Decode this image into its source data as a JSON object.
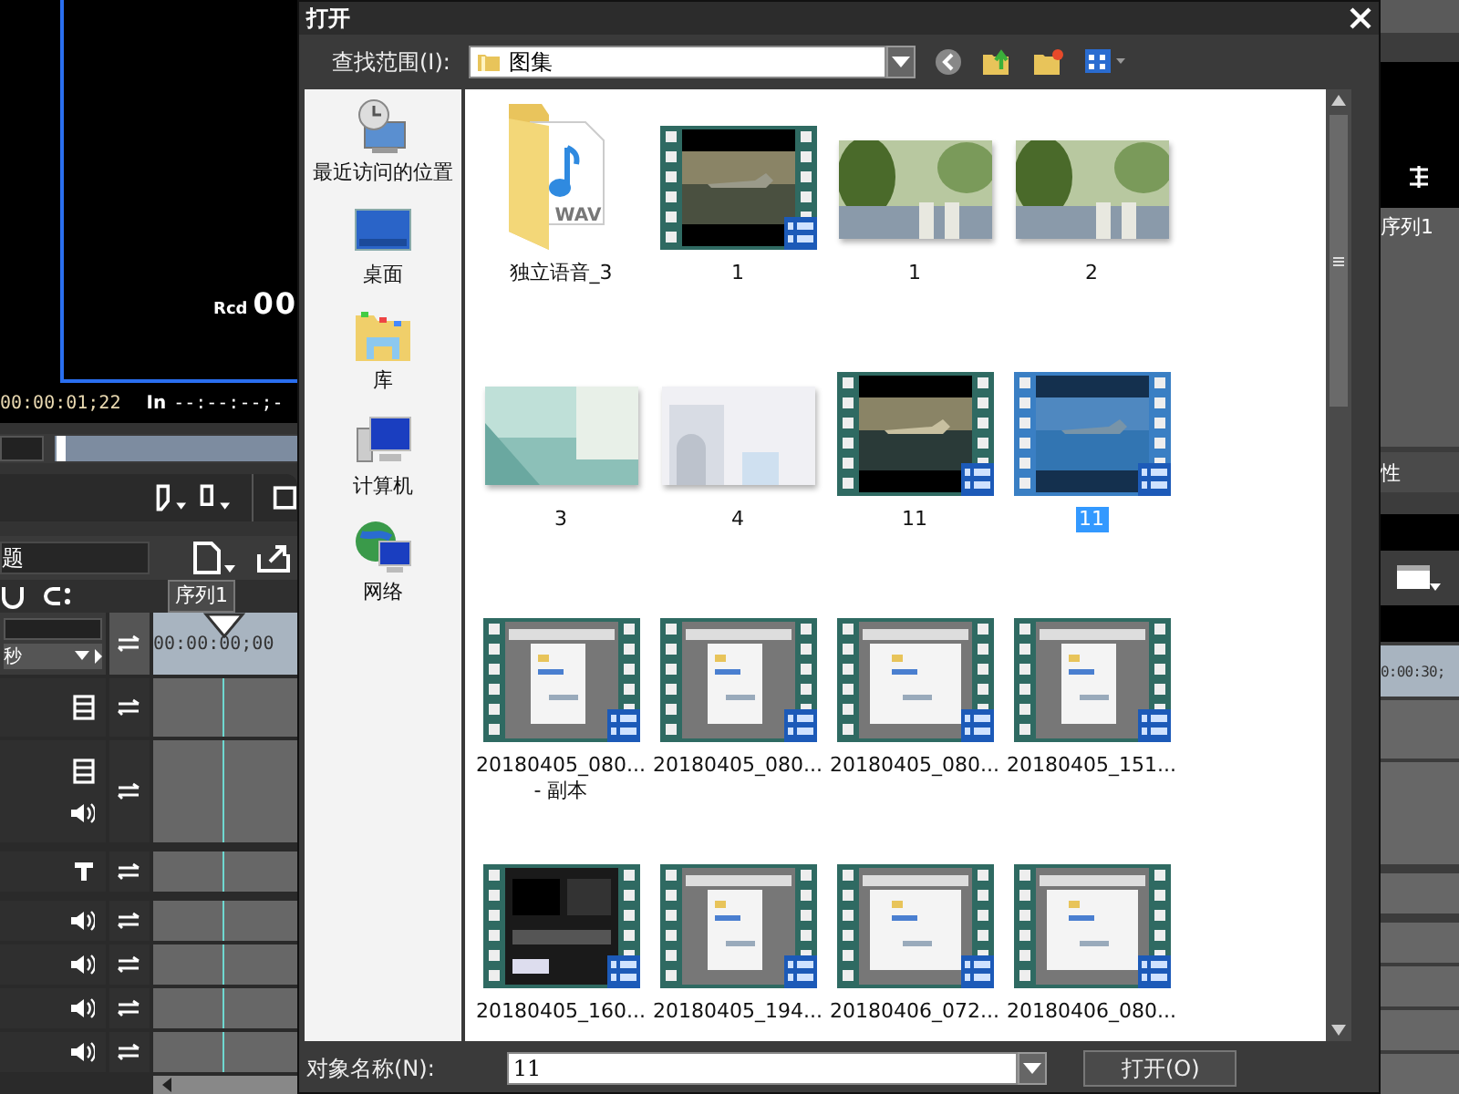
{
  "background_app": {
    "monitor": {
      "rcd_label": "Rcd",
      "rcd_value": "00"
    },
    "timecode": "00:00:01;22",
    "position": {
      "level": 0.01
    },
    "in_label": "In",
    "in_value": "--:--:--;-",
    "bin_title": "题",
    "unit": "秒",
    "sequence_tab": "序列1",
    "ruler_time": "00:00:00;00",
    "right_panel": {
      "sequence": "序列1",
      "property": "性",
      "ruler_time": "0:00:30;"
    }
  },
  "dialog": {
    "title": "打开",
    "look_in_label": "查找范围(I):",
    "look_in_value": "图集",
    "places": [
      {
        "kind": "recent",
        "label": "最近访问的位置"
      },
      {
        "kind": "desktop",
        "label": "桌面"
      },
      {
        "kind": "library",
        "label": "库"
      },
      {
        "kind": "computer",
        "label": "计算机"
      },
      {
        "kind": "network",
        "label": "网络"
      }
    ],
    "files": [
      {
        "kind": "folder",
        "name": "独立语音_3",
        "badge": "WAV",
        "selected": false
      },
      {
        "kind": "video",
        "name": "1",
        "selected": false
      },
      {
        "name": "1",
        "selected": false
      },
      {
        "name": "2",
        "selected": false
      },
      {
        "name": "3",
        "selected": false
      },
      {
        "name": "4",
        "selected": false
      },
      {
        "kind": "video",
        "name": "11",
        "selected": false
      },
      {
        "kind": "video",
        "name": "11",
        "selected": true
      },
      {
        "kind": "video",
        "name": "20180405_080... - 副本",
        "selected": false
      },
      {
        "kind": "video",
        "name": "20180405_080...",
        "selected": false
      },
      {
        "kind": "video",
        "name": "20180405_080...",
        "selected": false
      },
      {
        "kind": "video",
        "name": "20180405_151...",
        "selected": false
      },
      {
        "kind": "video",
        "name": "20180405_160...",
        "selected": false
      },
      {
        "kind": "video",
        "name": "20180405_194...",
        "selected": false
      },
      {
        "kind": "video",
        "name": "20180406_072...",
        "selected": false
      },
      {
        "kind": "video",
        "name": "20180406_080...",
        "selected": false
      }
    ],
    "file_name_label": "对象名称(N):",
    "file_name_value": "11",
    "open_button": "打开(O)"
  }
}
